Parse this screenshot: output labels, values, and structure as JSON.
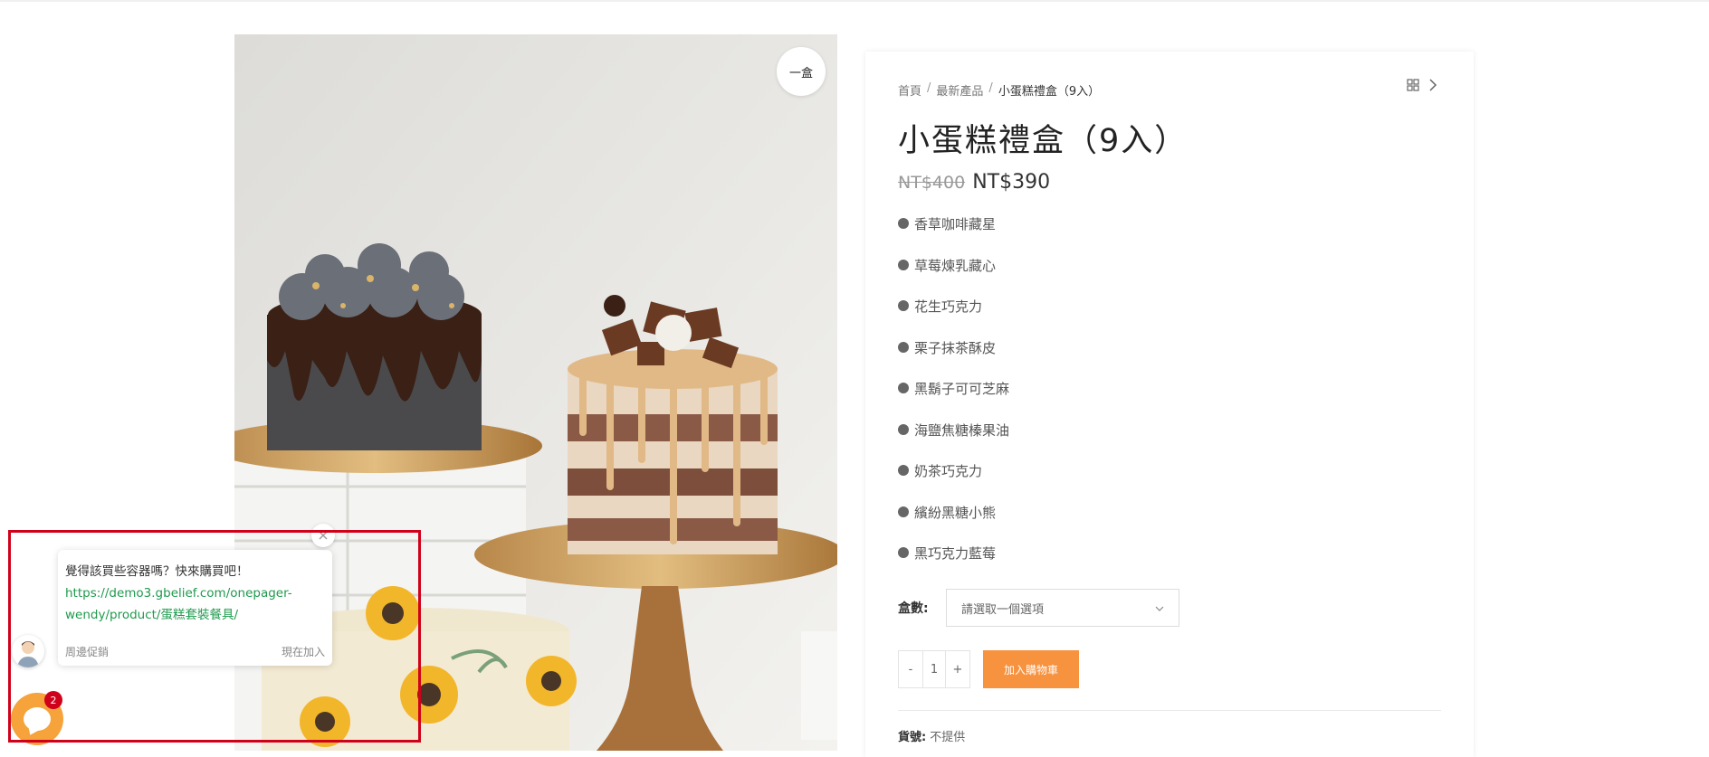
{
  "product": {
    "image_alt": "小蛋糕禮盒（9入）",
    "badge": "一盒",
    "breadcrumb": [
      "首頁",
      "最新產品",
      "小蛋糕禮盒（9入）"
    ],
    "title": "小蛋糕禮盒（9入）",
    "price_old": "NT$400",
    "price_new": "NT$390",
    "flavors": [
      "香草咖啡藏星",
      "草莓煉乳藏心",
      "花生巧克力",
      "栗子抹茶酥皮",
      "黑鬍子可可芝麻",
      "海鹽焦糖榛果油",
      "奶茶巧克力",
      "繽紛黑糖小熊",
      "黑巧克力藍莓"
    ],
    "qty_label": "盒數:",
    "select_placeholder": "請選取一個選項",
    "quantity": "1",
    "minus": "-",
    "plus": "+",
    "add_to_cart": "加入購物車",
    "sku_label": "貨號:",
    "sku_value": "不提供"
  },
  "chat": {
    "message": "覺得該買些容器嗎？快來購買吧！",
    "link": "https://demo3.gbelief.com/onepager-wendy/product/蛋糕套裝餐具/",
    "footer_left": "周邊促銷",
    "footer_right": "現在加入",
    "unread_count": "2"
  },
  "colors": {
    "accent": "#f7923f",
    "link": "#1f9a4d",
    "highlight": "#d0021b",
    "launcher": "#f5a33a"
  }
}
